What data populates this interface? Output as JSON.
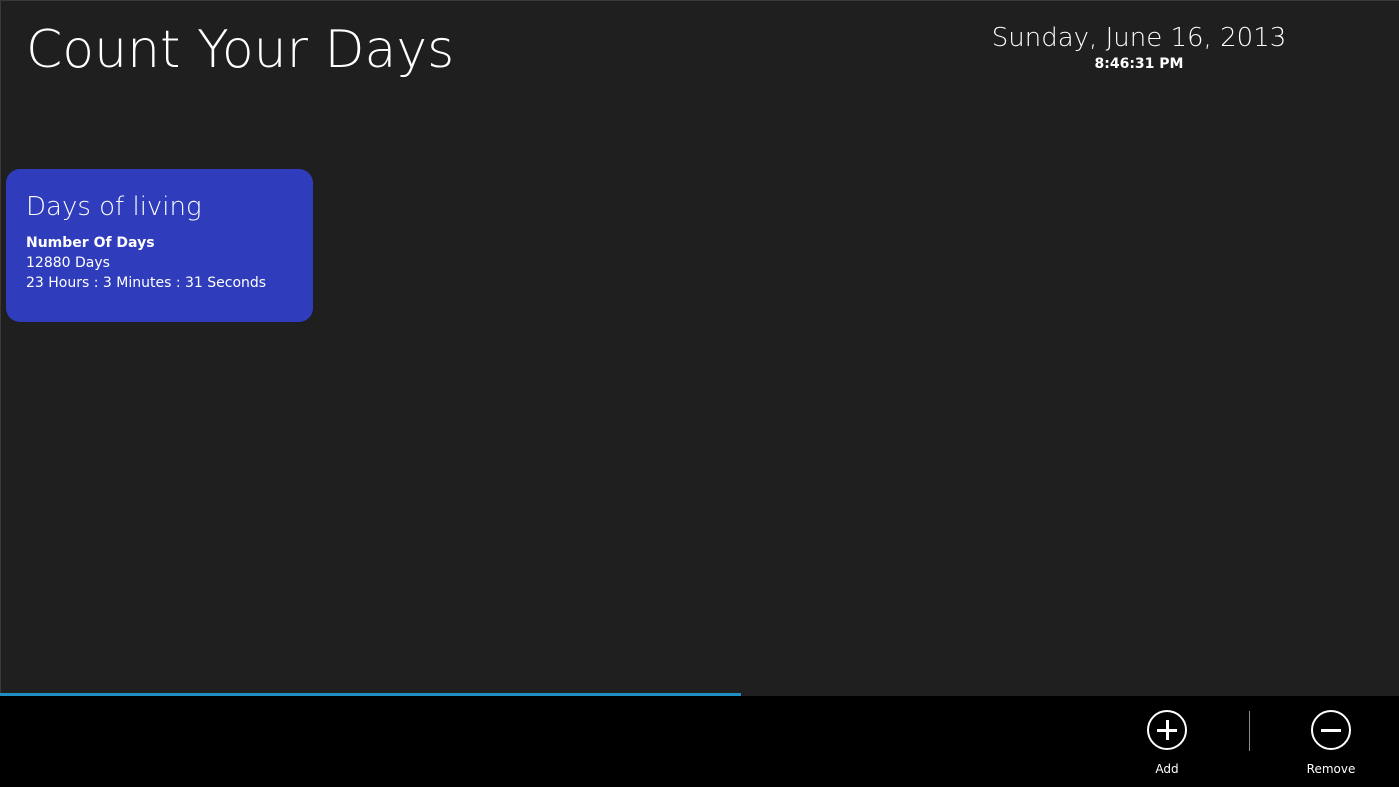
{
  "app": {
    "title": "Count Your Days"
  },
  "clock": {
    "date": "Sunday, June 16, 2013",
    "time": "8:46:31 PM"
  },
  "tiles": [
    {
      "title": "Days of living",
      "heading": "Number Of Days",
      "days": "12880 Days",
      "time": "23 Hours : 3 Minutes : 31 Seconds",
      "color": "#2f3dbd"
    }
  ],
  "progress": {
    "value_percent": 53,
    "color": "#1d8fc4"
  },
  "appbar": {
    "add_label": "Add",
    "add_icon": "add-circle-icon",
    "remove_label": "Remove",
    "remove_icon": "remove-circle-icon"
  }
}
